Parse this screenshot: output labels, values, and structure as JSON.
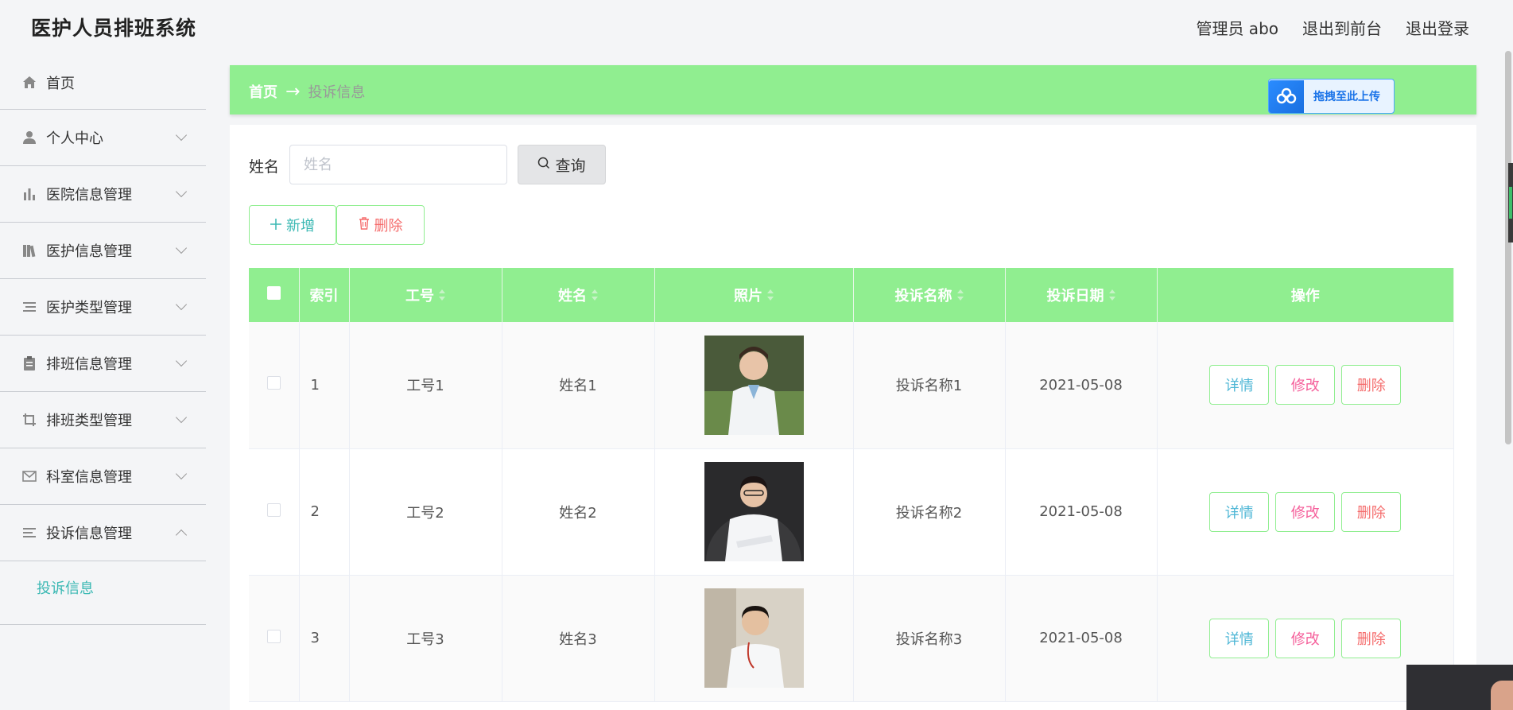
{
  "header": {
    "title": "医护人员排班系统",
    "links": [
      "管理员 abo",
      "退出到前台",
      "退出登录"
    ]
  },
  "sidebar": {
    "items": [
      {
        "label": "首页",
        "icon": "home-icon"
      },
      {
        "label": "个人中心",
        "icon": "user-icon"
      },
      {
        "label": "医院信息管理",
        "icon": "bar-chart-icon"
      },
      {
        "label": "医护信息管理",
        "icon": "books-icon"
      },
      {
        "label": "医护类型管理",
        "icon": "list-icon"
      },
      {
        "label": "排班信息管理",
        "icon": "clipboard-icon"
      },
      {
        "label": "排班类型管理",
        "icon": "crop-icon"
      },
      {
        "label": "科室信息管理",
        "icon": "mail-icon"
      },
      {
        "label": "投诉信息管理",
        "icon": "menu-icon"
      }
    ],
    "sub_item": "投诉信息"
  },
  "breadcrumb": {
    "home": "首页",
    "arrow": "→",
    "current": "投诉信息"
  },
  "upload_badge": "拖拽至此上传",
  "search": {
    "label": "姓名",
    "placeholder": "姓名",
    "button": "查询"
  },
  "actions": {
    "add": "新增",
    "delete": "删除"
  },
  "table": {
    "headers": [
      "索引",
      "工号",
      "姓名",
      "照片",
      "投诉名称",
      "投诉日期",
      "操作"
    ],
    "rows": [
      {
        "index": "1",
        "job_no": "工号1",
        "name": "姓名1",
        "complaint": "投诉名称1",
        "date": "2021-05-08"
      },
      {
        "index": "2",
        "job_no": "工号2",
        "name": "姓名2",
        "complaint": "投诉名称2",
        "date": "2021-05-08"
      },
      {
        "index": "3",
        "job_no": "工号3",
        "name": "姓名3",
        "complaint": "投诉名称3",
        "date": "2021-05-08"
      }
    ],
    "row_actions": {
      "detail": "详情",
      "edit": "修改",
      "delete": "删除"
    }
  },
  "colors": {
    "accent": "#90ee90",
    "teal": "#3ab8b3",
    "danger": "#f56c6c",
    "edit": "#f55e9a",
    "detail": "#4fb7d6"
  }
}
